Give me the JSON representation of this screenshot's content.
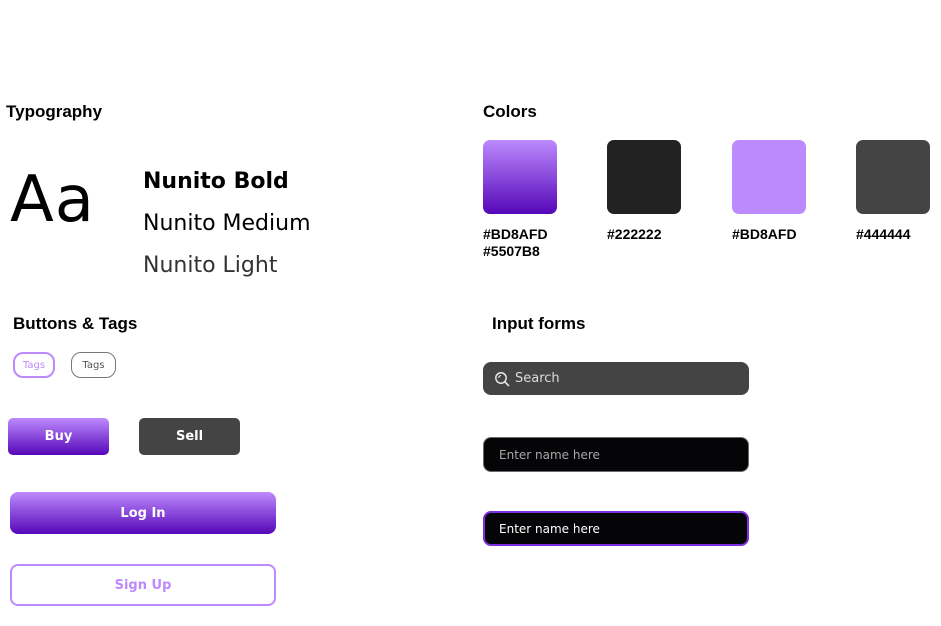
{
  "typography": {
    "title": "Typography",
    "sample_glyph": "Aa",
    "fonts": [
      "Nunito Bold",
      "Nunito Medium",
      "Nunito Light"
    ]
  },
  "colors": {
    "title": "Colors",
    "swatches": [
      {
        "label_line1": "#BD8AFD",
        "label_line2": "#5507B8",
        "fill": "linear-gradient(180deg, #BD8AFD, #5507B8)"
      },
      {
        "label_line1": "#222222",
        "fill": "#222222"
      },
      {
        "label_line1": "#BD8AFD",
        "fill": "#BD8AFD"
      },
      {
        "label_line1": "#444444",
        "fill": "#444444"
      }
    ]
  },
  "buttons": {
    "title": "Buttons & Tags",
    "tags": [
      "Tags",
      "Tags"
    ],
    "buy_label": "Buy",
    "sell_label": "Sell",
    "login_label": "Log In",
    "signup_label": "Sign Up"
  },
  "inputs": {
    "title": "Input forms",
    "search_placeholder": "Search",
    "name_placeholder_1": "Enter name here",
    "name_placeholder_2": "Enter name here"
  },
  "icons": {
    "search": "search-icon"
  },
  "palette": {
    "accent_light": "#BD8AFD",
    "accent_dark": "#5507B8",
    "dark": "#222222",
    "gray": "#444444"
  }
}
